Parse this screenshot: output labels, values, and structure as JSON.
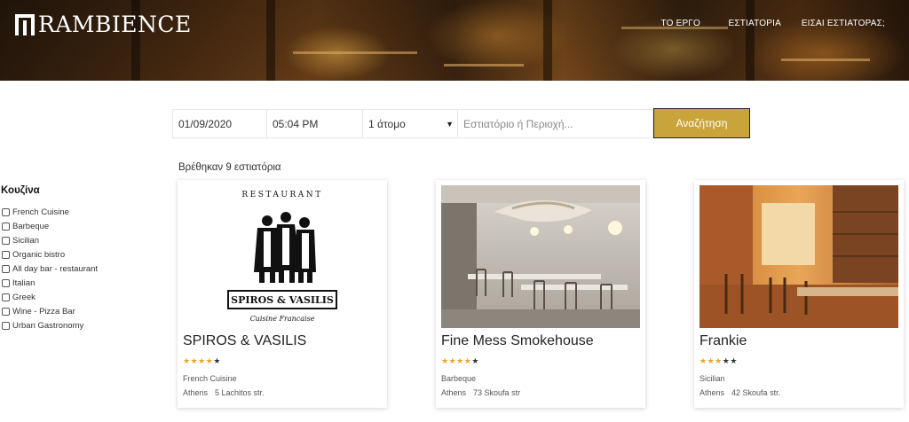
{
  "header": {
    "logo_text": "RAMBIENCE",
    "nav": [
      {
        "label": "ΤΟ ΕΡΓΟ"
      },
      {
        "label": "ΕΣΤΙΑΤΟΡΙΑ"
      },
      {
        "label": "ΕΙΣΑΙ ΕΣΤΙΑΤΟΡΑΣ;"
      }
    ]
  },
  "search": {
    "date": "01/09/2020",
    "time": "05:04 PM",
    "people": "1 άτομο",
    "query_placeholder": "Εστιατόριο ή Περιοχή...",
    "button_label": "Αναζήτηση"
  },
  "results_count": "Βρέθηκαν 9 εστιατόρια",
  "filters": {
    "title": "Κουζίνα",
    "items": [
      {
        "label": "French Cuisine",
        "checked": false
      },
      {
        "label": "Barbeque",
        "checked": false
      },
      {
        "label": "Sicilian",
        "checked": false
      },
      {
        "label": "Organic bistro",
        "checked": false
      },
      {
        "label": "All day bar - restaurant",
        "checked": false
      },
      {
        "label": "Italian",
        "checked": false
      },
      {
        "label": "Greek",
        "checked": false
      },
      {
        "label": "Wine - Pizza Bar",
        "checked": false
      },
      {
        "label": "Urban Gastronomy",
        "checked": false
      }
    ]
  },
  "restaurants": [
    {
      "name": "SPIROS & VASILIS",
      "rating": 4,
      "max_rating": 5,
      "cuisine": "French Cuisine",
      "city": "Athens",
      "address": "5 Lachitos str.",
      "logo": {
        "top": "RESTAURANT",
        "band": "SPIROS & VASILIS",
        "sub": "Cuisine Francaise"
      }
    },
    {
      "name": "Fine Mess Smokehouse",
      "rating": 4,
      "max_rating": 5,
      "cuisine": "Barbeque",
      "city": "Athens",
      "address": "73 Skoufa str"
    },
    {
      "name": "Frankie",
      "rating": 3,
      "max_rating": 5,
      "cuisine": "Sicilian",
      "city": "Athens",
      "address": "42 Skoufa str."
    }
  ],
  "colors": {
    "accent": "#c9a43a",
    "star_filled": "#e6a524",
    "star_empty": "#333333"
  },
  "icons": {
    "star_filled": "★",
    "star_empty": "★",
    "dropdown": "chevron-down-icon"
  }
}
